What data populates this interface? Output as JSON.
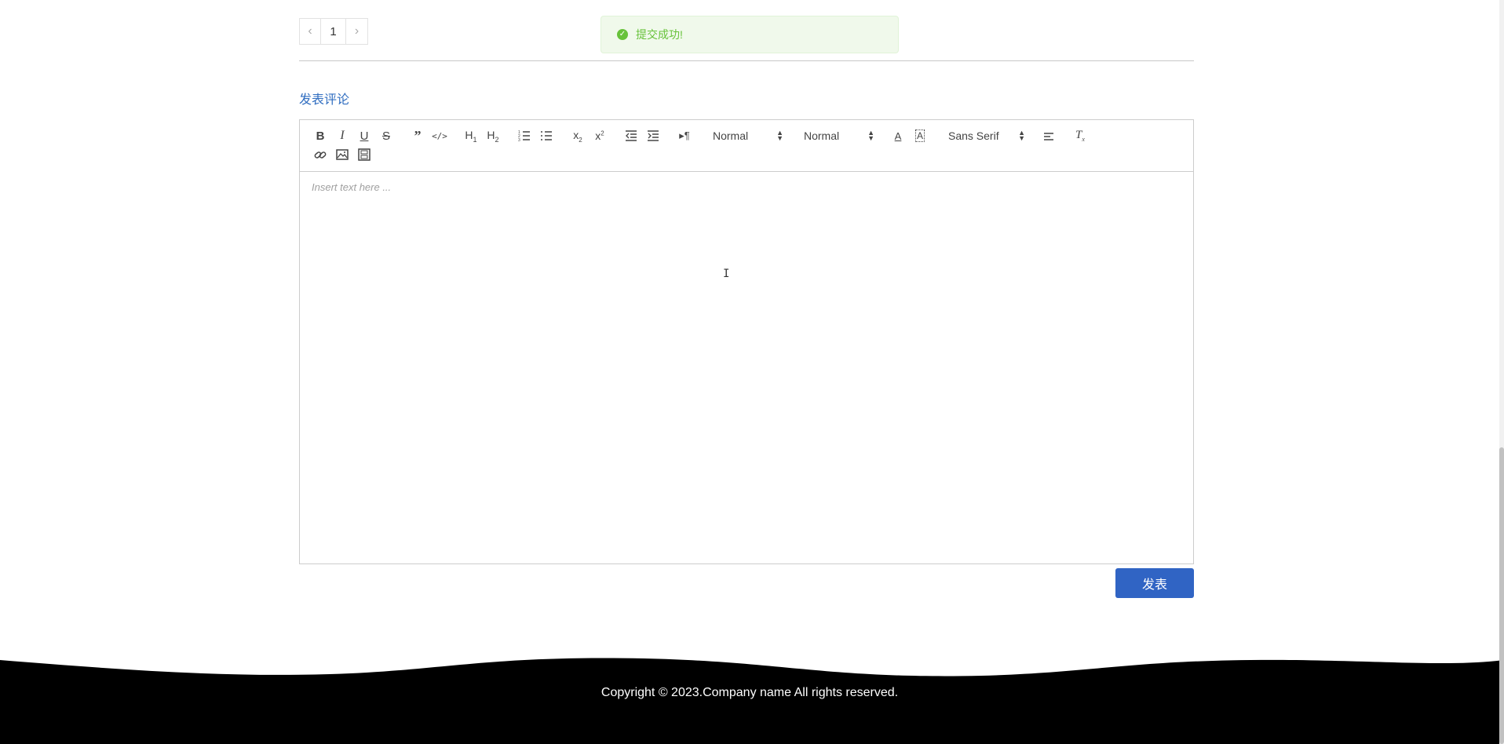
{
  "pagination": {
    "prev": "‹",
    "current": "1",
    "next": "›"
  },
  "toast": {
    "message": "提交成功!",
    "color": "#67c23a"
  },
  "comment": {
    "section_title": "发表评论",
    "placeholder": "Insert text here ...",
    "submit_label": "发表"
  },
  "toolbar": {
    "header_select": "Normal",
    "size_select": "Normal",
    "font_select": "Sans Serif"
  },
  "footer": {
    "copyright": "Copyright © 2023.Company name All rights reserved."
  },
  "colors": {
    "accent": "#3064c4",
    "title": "#2f6dc0",
    "footer_bg": "#000000"
  }
}
